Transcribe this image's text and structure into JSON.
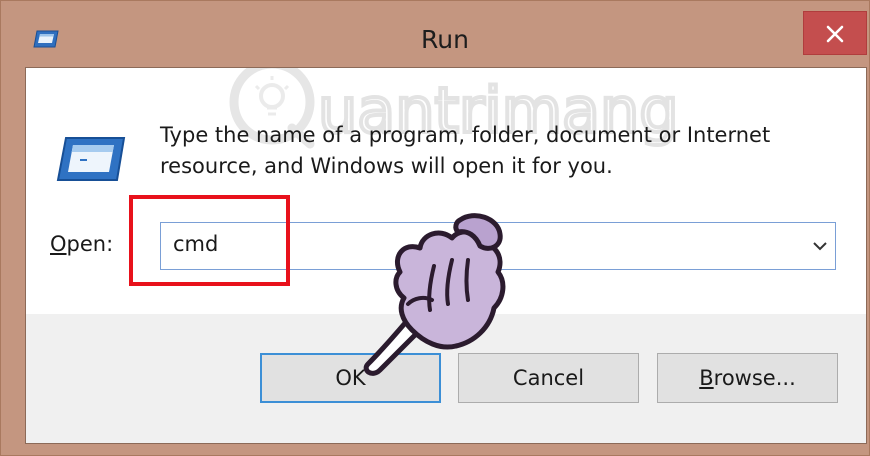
{
  "window": {
    "title": "Run",
    "title_icon": "run-icon",
    "close_icon": "close-icon"
  },
  "dialog": {
    "icon": "run-program-icon",
    "message_line1": "Type the name of a program, folder, document or Internet",
    "message_line2": "resource, and Windows will open it for you.",
    "open_label_accel": "O",
    "open_label_rest": "pen:",
    "open_value": "cmd",
    "dropdown_icon": "chevron-down-icon"
  },
  "buttons": {
    "ok": "OK",
    "cancel": "Cancel",
    "browse_accel": "B",
    "browse_rest": "rowse..."
  },
  "overlay": {
    "watermark_text": "uantrimang",
    "hand_icon": "pointing-hand-icon",
    "highlight_color": "#e8111b"
  },
  "colors": {
    "frame": "#c49680",
    "close_button": "#c44e4e",
    "default_button_border": "#3c8fd6",
    "input_border": "#7a9fd6"
  }
}
